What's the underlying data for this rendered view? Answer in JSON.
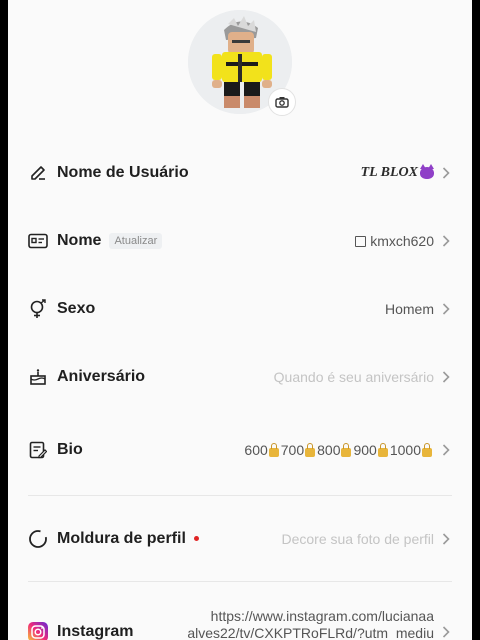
{
  "profile": {
    "avatar_alt": "avatar",
    "camera_icon": "camera-icon"
  },
  "rows": {
    "username": {
      "label": "Nome de Usuário",
      "value": "TL BLOX",
      "icon": "pencil-icon"
    },
    "name": {
      "label": "Nome",
      "badge": "Atualizar",
      "value": "kmxch620",
      "icon": "id-card-icon"
    },
    "gender": {
      "label": "Sexo",
      "value": "Homem",
      "icon": "gender-icon"
    },
    "birthday": {
      "label": "Aniversário",
      "value": "Quando é seu aniversário",
      "icon": "cake-icon"
    },
    "bio": {
      "label": "Bio",
      "icon": "note-icon",
      "items": [
        "600",
        "700",
        "800",
        "900",
        "1000"
      ]
    },
    "frame": {
      "label": "Moldura de perfil",
      "value": "Decore sua foto de perfil",
      "icon": "frame-icon"
    },
    "instagram": {
      "label": "Instagram",
      "value_line1": "https://www.instagram.com/lucianaa",
      "value_line2": "alves22/tv/CXKPTRoFLRd/?utm_mediu",
      "icon": "instagram-icon"
    }
  },
  "colors": {
    "accent_red": "#e02424",
    "instagram_gradient": [
      "#f9ce34",
      "#ee2a7b",
      "#6228d7"
    ]
  }
}
